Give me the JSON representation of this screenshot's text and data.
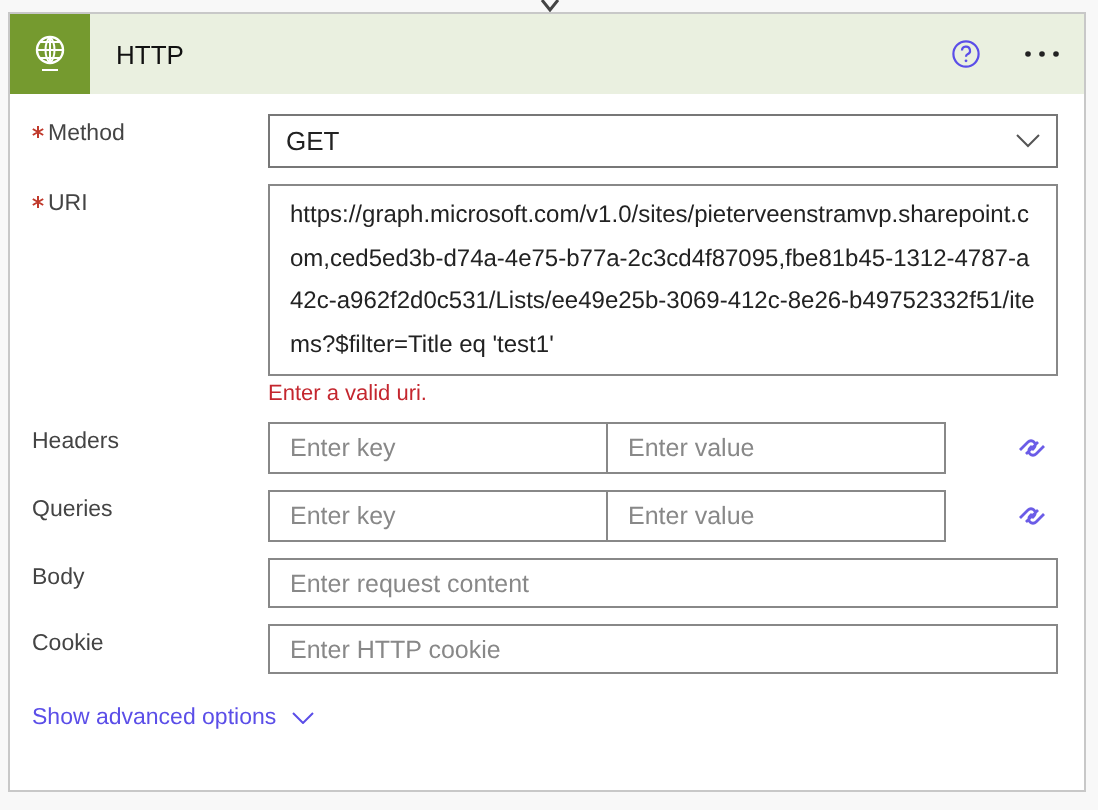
{
  "card": {
    "title": "HTTP"
  },
  "fields": [
    {
      "kind": "dropdown",
      "label": "Method",
      "required": true,
      "value": "GET"
    },
    {
      "kind": "textarea",
      "label": "URI",
      "required": true,
      "value": "https://graph.microsoft.com/v1.0/sites/pieterveenstramvp.sharepoint.com,ced5ed3b-d74a-4e75-b77a-2c3cd4f87095,fbe81b45-1312-4787-a42c-a962f2d0c531/Lists/ee49e25b-3069-412c-8e26-b49752332f51/items?$filter=Title eq 'test1'",
      "error": "Enter a valid uri."
    },
    {
      "kind": "keyvalue",
      "label": "Headers",
      "required": false,
      "key_placeholder": "Enter key",
      "value_placeholder": "Enter value"
    },
    {
      "kind": "keyvalue",
      "label": "Queries",
      "required": false,
      "key_placeholder": "Enter key",
      "value_placeholder": "Enter value"
    },
    {
      "kind": "text",
      "label": "Body",
      "required": false,
      "placeholder": "Enter request content"
    },
    {
      "kind": "text",
      "label": "Cookie",
      "required": false,
      "placeholder": "Enter HTTP cookie"
    }
  ],
  "advanced_link": "Show advanced options"
}
